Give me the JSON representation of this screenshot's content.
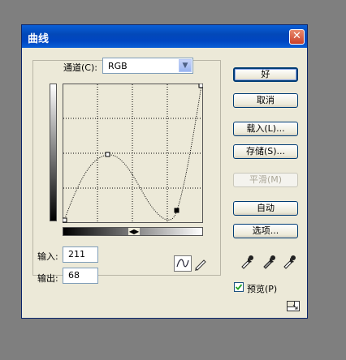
{
  "window": {
    "title": "曲线",
    "close_glyph": "✕"
  },
  "channel": {
    "label": "通道(C):",
    "value": "RGB"
  },
  "input": {
    "label": "输入:",
    "value": "211"
  },
  "output": {
    "label": "输出:",
    "value": "68"
  },
  "buttons": {
    "ok": "好",
    "cancel": "取消",
    "load": "载入(L)...",
    "save": "存储(S)...",
    "smooth": "平滑(M)",
    "auto": "自动",
    "options": "选项..."
  },
  "preview": {
    "label": "预览(P)",
    "checked": true
  },
  "colors": {
    "titlebar": "#0a5fd6",
    "dialog_bg": "#ece9d8",
    "curve": "#000000"
  }
}
